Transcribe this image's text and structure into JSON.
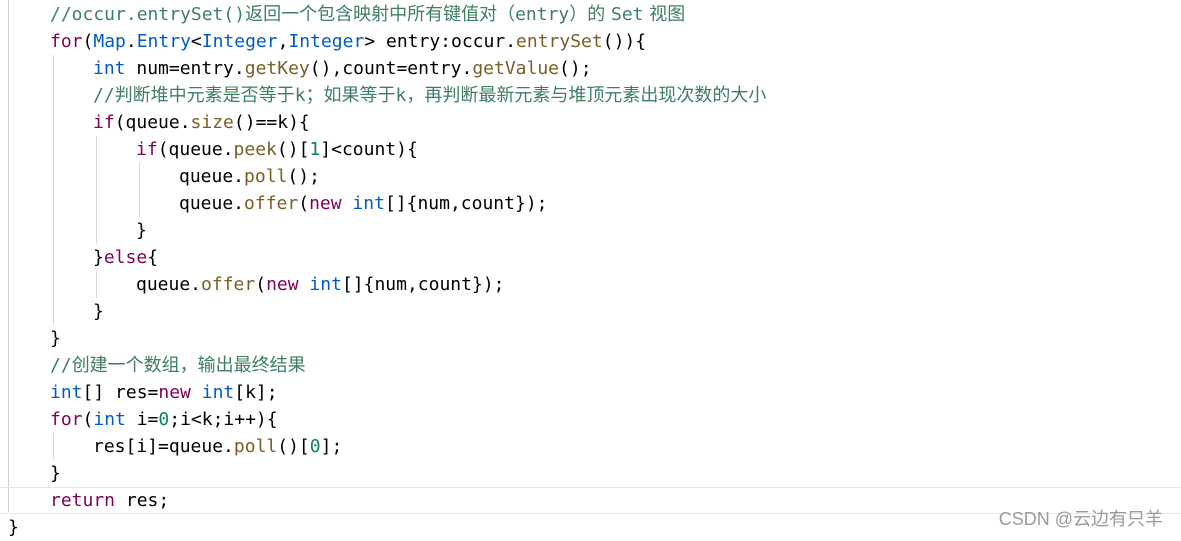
{
  "code": {
    "lines": [
      {
        "tokens": [
          {
            "t": "//occur.entrySet()",
            "c": "cm"
          },
          {
            "t": "返回一个包含映射中所有键值对（",
            "c": "cm cjk"
          },
          {
            "t": "entry",
            "c": "cm"
          },
          {
            "t": "）的 ",
            "c": "cm cjk"
          },
          {
            "t": "Set",
            "c": "cm"
          },
          {
            "t": " 视图",
            "c": "cm cjk"
          }
        ]
      },
      {
        "tokens": [
          {
            "t": "for",
            "c": "kw"
          },
          {
            "t": "(",
            "c": "cn"
          },
          {
            "t": "Map",
            "c": "tp"
          },
          {
            "t": ".",
            "c": "cn"
          },
          {
            "t": "Entry",
            "c": "tp"
          },
          {
            "t": "<",
            "c": "cn"
          },
          {
            "t": "Integer",
            "c": "tp"
          },
          {
            "t": ",",
            "c": "cn"
          },
          {
            "t": "Integer",
            "c": "tp"
          },
          {
            "t": "> entry:occur.",
            "c": "cn"
          },
          {
            "t": "entrySet",
            "c": "mt"
          },
          {
            "t": "()){",
            "c": "cn"
          }
        ]
      },
      {
        "tokens": [
          {
            "t": "int",
            "c": "tp"
          },
          {
            "t": " num=entry.",
            "c": "cn"
          },
          {
            "t": "getKey",
            "c": "mt"
          },
          {
            "t": "(),count=entry.",
            "c": "cn"
          },
          {
            "t": "getValue",
            "c": "mt"
          },
          {
            "t": "();",
            "c": "cn"
          }
        ]
      },
      {
        "tokens": [
          {
            "t": "//",
            "c": "cm"
          },
          {
            "t": "判断堆中元素是否等于",
            "c": "cm cjk"
          },
          {
            "t": "k",
            "c": "cm"
          },
          {
            "t": "；如果等于",
            "c": "cm cjk"
          },
          {
            "t": "k",
            "c": "cm"
          },
          {
            "t": "，再判断最新元素与堆顶元素出现次数的大小",
            "c": "cm cjk"
          }
        ]
      },
      {
        "tokens": [
          {
            "t": "if",
            "c": "kw"
          },
          {
            "t": "(queue.",
            "c": "cn"
          },
          {
            "t": "size",
            "c": "mt"
          },
          {
            "t": "()==k){",
            "c": "cn"
          }
        ]
      },
      {
        "tokens": [
          {
            "t": "if",
            "c": "kw"
          },
          {
            "t": "(queue.",
            "c": "cn"
          },
          {
            "t": "peek",
            "c": "mt"
          },
          {
            "t": "()[",
            "c": "cn"
          },
          {
            "t": "1",
            "c": "nm"
          },
          {
            "t": "]<count){",
            "c": "cn"
          }
        ]
      },
      {
        "tokens": [
          {
            "t": "queue.",
            "c": "cn"
          },
          {
            "t": "poll",
            "c": "mt"
          },
          {
            "t": "();",
            "c": "cn"
          }
        ]
      },
      {
        "tokens": [
          {
            "t": "queue.",
            "c": "cn"
          },
          {
            "t": "offer",
            "c": "mt"
          },
          {
            "t": "(",
            "c": "cn"
          },
          {
            "t": "new",
            "c": "kw"
          },
          {
            "t": " ",
            "c": "cn"
          },
          {
            "t": "int",
            "c": "tp"
          },
          {
            "t": "[]{num,count});",
            "c": "cn"
          }
        ]
      },
      {
        "tokens": [
          {
            "t": "}",
            "c": "cn"
          }
        ]
      },
      {
        "tokens": [
          {
            "t": "}",
            "c": "cn"
          },
          {
            "t": "else",
            "c": "kw"
          },
          {
            "t": "{",
            "c": "cn"
          }
        ]
      },
      {
        "tokens": [
          {
            "t": "queue.",
            "c": "cn"
          },
          {
            "t": "offer",
            "c": "mt"
          },
          {
            "t": "(",
            "c": "cn"
          },
          {
            "t": "new",
            "c": "kw"
          },
          {
            "t": " ",
            "c": "cn"
          },
          {
            "t": "int",
            "c": "tp"
          },
          {
            "t": "[]{num,count});",
            "c": "cn"
          }
        ]
      },
      {
        "tokens": [
          {
            "t": "}",
            "c": "cn"
          }
        ]
      },
      {
        "tokens": [
          {
            "t": "}",
            "c": "cn"
          }
        ]
      },
      {
        "tokens": [
          {
            "t": "//",
            "c": "cm"
          },
          {
            "t": "创建一个数组，输出最终结果",
            "c": "cm cjk"
          }
        ]
      },
      {
        "tokens": [
          {
            "t": "int",
            "c": "tp"
          },
          {
            "t": "[] res=",
            "c": "cn"
          },
          {
            "t": "new",
            "c": "kw"
          },
          {
            "t": " ",
            "c": "cn"
          },
          {
            "t": "int",
            "c": "tp"
          },
          {
            "t": "[k];",
            "c": "cn"
          }
        ]
      },
      {
        "tokens": [
          {
            "t": "for",
            "c": "kw"
          },
          {
            "t": "(",
            "c": "cn"
          },
          {
            "t": "int",
            "c": "tp"
          },
          {
            "t": " i=",
            "c": "cn"
          },
          {
            "t": "0",
            "c": "nm"
          },
          {
            "t": ";i<k;i++){",
            "c": "cn"
          }
        ]
      },
      {
        "tokens": [
          {
            "t": "res[i]=queue.",
            "c": "cn"
          },
          {
            "t": "poll",
            "c": "mt"
          },
          {
            "t": "()[",
            "c": "cn"
          },
          {
            "t": "0",
            "c": "nm"
          },
          {
            "t": "];",
            "c": "cn"
          }
        ]
      },
      {
        "tokens": [
          {
            "t": "}",
            "c": "cn"
          }
        ]
      },
      {
        "tokens": [
          {
            "t": "return",
            "c": "kw"
          },
          {
            "t": " res;",
            "c": "cn"
          }
        ]
      },
      {
        "tokens": [
          {
            "t": "}",
            "c": "cn"
          }
        ]
      }
    ]
  },
  "watermark": "CSDN @云边有只羊"
}
